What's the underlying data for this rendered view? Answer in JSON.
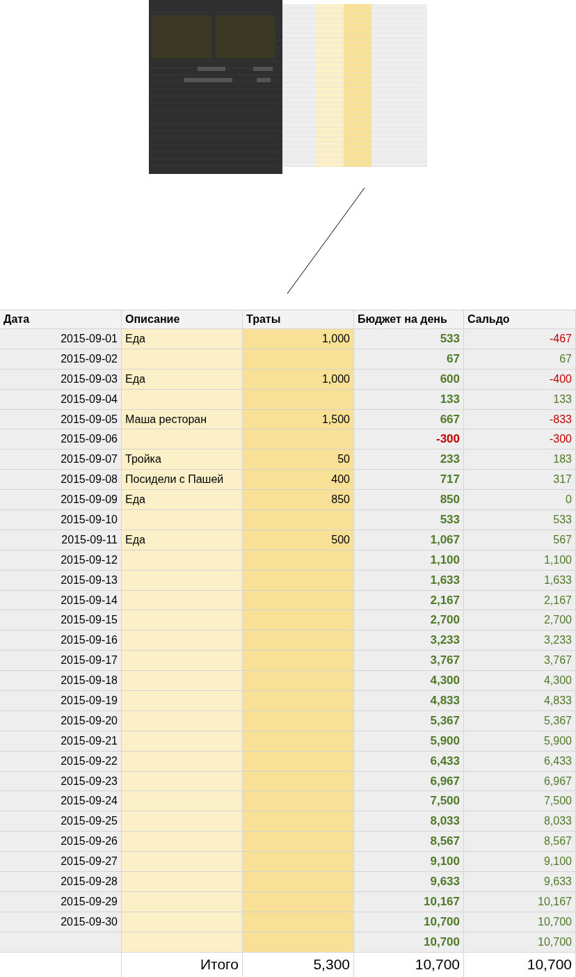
{
  "table": {
    "columns": [
      "Дата",
      "Описание",
      "Траты",
      "Бюджет на день",
      "Сальдо"
    ],
    "rows": [
      {
        "date": "2015-09-01",
        "description": "Еда",
        "spending": "1,000",
        "budget": "533",
        "budget_negative": false,
        "saldo": "-467",
        "saldo_negative": true
      },
      {
        "date": "2015-09-02",
        "budget": "67",
        "budget_negative": false,
        "saldo": "67",
        "saldo_negative": false
      },
      {
        "date": "2015-09-03",
        "description": "Еда",
        "spending": "1,000",
        "budget": "600",
        "budget_negative": false,
        "saldo": "-400",
        "saldo_negative": true
      },
      {
        "date": "2015-09-04",
        "budget": "133",
        "budget_negative": false,
        "saldo": "133",
        "saldo_negative": false
      },
      {
        "date": "2015-09-05",
        "description": "Маша ресторан",
        "spending": "1,500",
        "budget": "667",
        "budget_negative": false,
        "saldo": "-833",
        "saldo_negative": true
      },
      {
        "date": "2015-09-06",
        "budget": "-300",
        "budget_negative": true,
        "saldo": "-300",
        "saldo_negative": true
      },
      {
        "date": "2015-09-07",
        "description": "Тройка",
        "spending": "50",
        "budget": "233",
        "budget_negative": false,
        "saldo": "183",
        "saldo_negative": false
      },
      {
        "date": "2015-09-08",
        "description": "Посидели с Пашей",
        "spending": "400",
        "budget": "717",
        "budget_negative": false,
        "saldo": "317",
        "saldo_negative": false
      },
      {
        "date": "2015-09-09",
        "description": "Еда",
        "spending": "850",
        "budget": "850",
        "budget_negative": false,
        "saldo": "0",
        "saldo_negative": false
      },
      {
        "date": "2015-09-10",
        "budget": "533",
        "budget_negative": false,
        "saldo": "533",
        "saldo_negative": false
      },
      {
        "date": "2015-09-11",
        "description": "Еда",
        "spending": "500",
        "budget": "1,067",
        "budget_negative": false,
        "saldo": "567",
        "saldo_negative": false
      },
      {
        "date": "2015-09-12",
        "budget": "1,100",
        "budget_negative": false,
        "saldo": "1,100",
        "saldo_negative": false
      },
      {
        "date": "2015-09-13",
        "budget": "1,633",
        "budget_negative": false,
        "saldo": "1,633",
        "saldo_negative": false
      },
      {
        "date": "2015-09-14",
        "budget": "2,167",
        "budget_negative": false,
        "saldo": "2,167",
        "saldo_negative": false
      },
      {
        "date": "2015-09-15",
        "budget": "2,700",
        "budget_negative": false,
        "saldo": "2,700",
        "saldo_negative": false
      },
      {
        "date": "2015-09-16",
        "budget": "3,233",
        "budget_negative": false,
        "saldo": "3,233",
        "saldo_negative": false
      },
      {
        "date": "2015-09-17",
        "budget": "3,767",
        "budget_negative": false,
        "saldo": "3,767",
        "saldo_negative": false
      },
      {
        "date": "2015-09-18",
        "budget": "4,300",
        "budget_negative": false,
        "saldo": "4,300",
        "saldo_negative": false
      },
      {
        "date": "2015-09-19",
        "budget": "4,833",
        "budget_negative": false,
        "saldo": "4,833",
        "saldo_negative": false
      },
      {
        "date": "2015-09-20",
        "budget": "5,367",
        "budget_negative": false,
        "saldo": "5,367",
        "saldo_negative": false
      },
      {
        "date": "2015-09-21",
        "budget": "5,900",
        "budget_negative": false,
        "saldo": "5,900",
        "saldo_negative": false
      },
      {
        "date": "2015-09-22",
        "budget": "6,433",
        "budget_negative": false,
        "saldo": "6,433",
        "saldo_negative": false
      },
      {
        "date": "2015-09-23",
        "budget": "6,967",
        "budget_negative": false,
        "saldo": "6,967",
        "saldo_negative": false
      },
      {
        "date": "2015-09-24",
        "budget": "7,500",
        "budget_negative": false,
        "saldo": "7,500",
        "saldo_negative": false
      },
      {
        "date": "2015-09-25",
        "budget": "8,033",
        "budget_negative": false,
        "saldo": "8,033",
        "saldo_negative": false
      },
      {
        "date": "2015-09-26",
        "budget": "8,567",
        "budget_negative": false,
        "saldo": "8,567",
        "saldo_negative": false
      },
      {
        "date": "2015-09-27",
        "budget": "9,100",
        "budget_negative": false,
        "saldo": "9,100",
        "saldo_negative": false
      },
      {
        "date": "2015-09-28",
        "budget": "9,633",
        "budget_negative": false,
        "saldo": "9,633",
        "saldo_negative": false
      },
      {
        "date": "2015-09-29",
        "budget": "10,167",
        "budget_negative": false,
        "saldo": "10,167",
        "saldo_negative": false
      },
      {
        "date": "2015-09-30",
        "budget": "10,700",
        "budget_negative": false,
        "saldo": "10,700",
        "saldo_negative": false
      },
      {
        "budget": "10,700",
        "budget_negative": false,
        "saldo": "10,700",
        "saldo_negative": false
      }
    ],
    "total": {
      "label": "Итого",
      "spending": "5,300",
      "budget": "10,700",
      "saldo": "10,700"
    }
  }
}
